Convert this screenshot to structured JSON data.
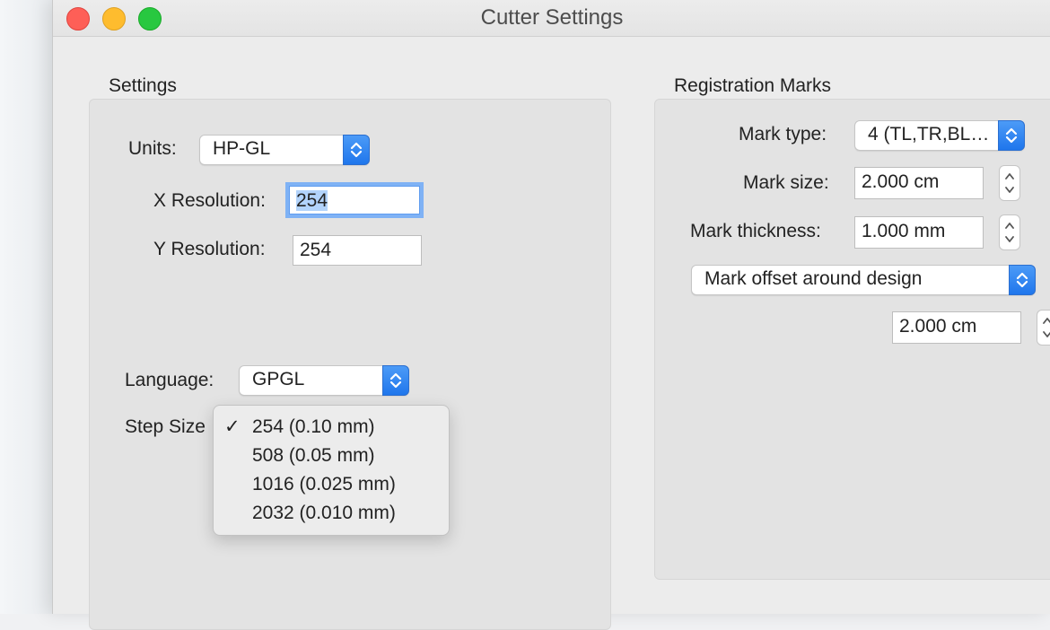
{
  "window": {
    "title": "Cutter Settings"
  },
  "settings": {
    "group_label": "Settings",
    "units_label": "Units:",
    "units_value": "HP-GL",
    "x_resolution_label": "X Resolution:",
    "x_resolution_value": "254",
    "y_resolution_label": "Y Resolution:",
    "y_resolution_value": "254",
    "language_label": "Language:",
    "language_value": "GPGL",
    "step_size_label": "Step Size",
    "step_size_menu": [
      {
        "label": "254 (0.10 mm)",
        "checked": true
      },
      {
        "label": "508 (0.05 mm)",
        "checked": false
      },
      {
        "label": "1016 (0.025 mm)",
        "checked": false
      },
      {
        "label": "2032 (0.010 mm)",
        "checked": false
      }
    ],
    "check_glyph": "✓"
  },
  "registration": {
    "group_label": "Registration Marks",
    "mark_type_label": "Mark type:",
    "mark_type_value": "4 (TL,TR,BL…",
    "mark_size_label": "Mark size:",
    "mark_size_value": "2.000 cm",
    "mark_thickness_label": "Mark thickness:",
    "mark_thickness_value": "1.000 mm",
    "offset_mode_value": "Mark offset around design",
    "offset_value": "2.000 cm"
  },
  "colors": {
    "accent": "#1f76ec",
    "selection": "#b2d3fb",
    "close": "#fe5f57",
    "minimize": "#febc2e",
    "maximize": "#28c840"
  }
}
